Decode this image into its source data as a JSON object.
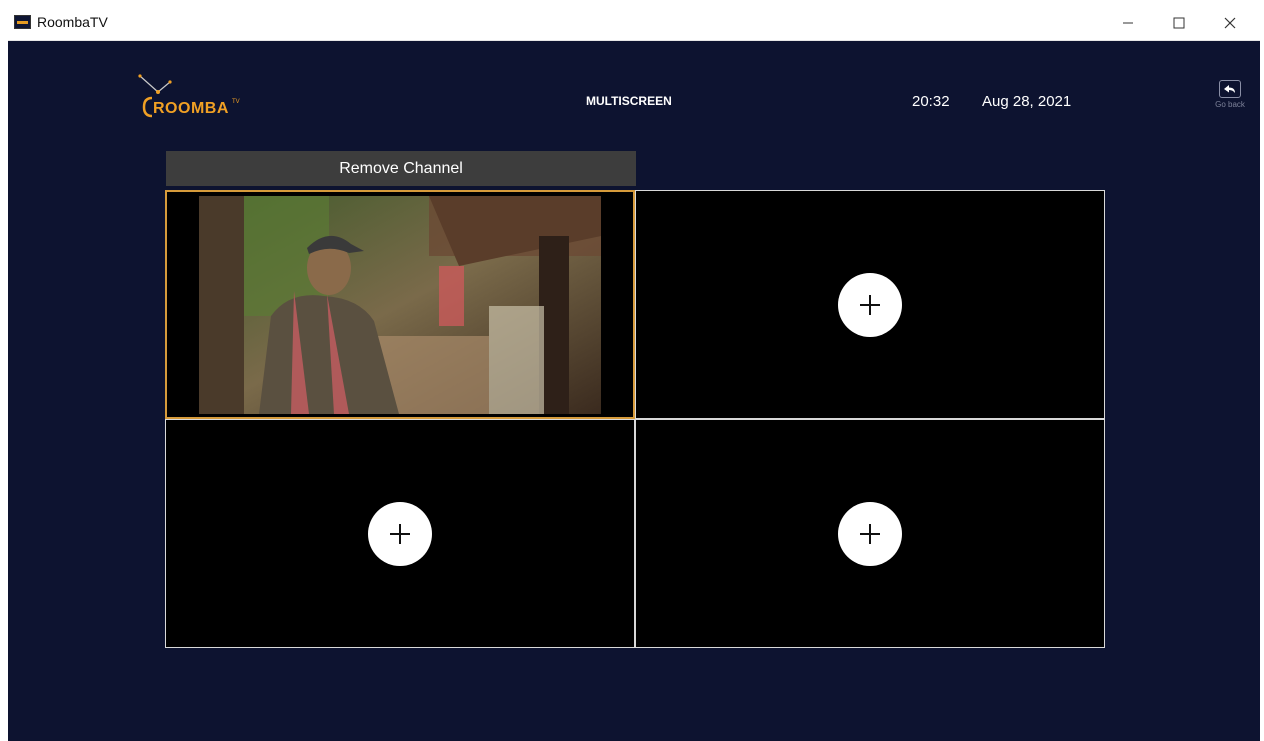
{
  "window": {
    "title": "RoombaTV",
    "minimize_icon": "minimize-icon",
    "maximize_icon": "maximize-icon",
    "close_icon": "close-icon"
  },
  "header": {
    "logo_text": "ROOMBA",
    "logo_sup": "TV",
    "page_title": "MULTISCREEN",
    "time": "20:32",
    "date": "Aug 28, 2021",
    "go_back_label": "Go back"
  },
  "toolbar": {
    "remove_channel_label": "Remove Channel"
  },
  "grid": {
    "cells": [
      {
        "state": "playing",
        "selected": true
      },
      {
        "state": "empty",
        "icon": "plus-icon"
      },
      {
        "state": "empty",
        "icon": "plus-icon"
      },
      {
        "state": "empty",
        "icon": "plus-icon"
      }
    ]
  },
  "colors": {
    "background": "#0d1330",
    "accent": "#f0a024",
    "selected_border": "#d69b3b",
    "button_bg": "#3d3d3d"
  }
}
